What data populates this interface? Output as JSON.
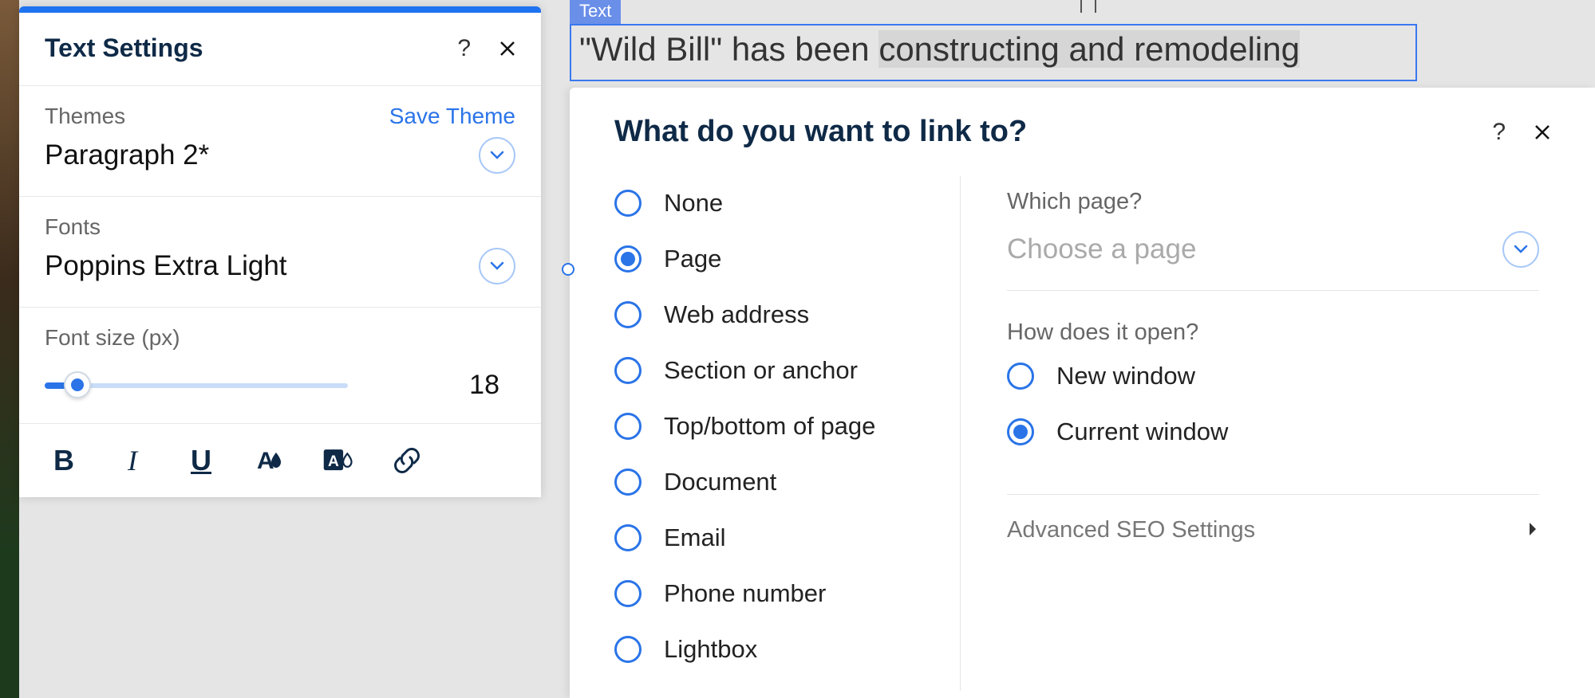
{
  "text_settings": {
    "title": "Text Settings",
    "themes_label": "Themes",
    "save_theme": "Save Theme",
    "theme_value": "Paragraph 2*",
    "fonts_label": "Fonts",
    "font_value": "Poppins Extra Light",
    "fontsize_label": "Font size (px)",
    "fontsize_value": "18",
    "toolbar": {
      "bold": "B",
      "italic": "I",
      "underline": "U"
    }
  },
  "canvas": {
    "badge": "Text",
    "line_prefix": "\"Wild Bill\" has been ",
    "line_highlight": "constructing and remodeling"
  },
  "link_panel": {
    "title": "What do you want to link to?",
    "options": [
      {
        "label": "None",
        "selected": false
      },
      {
        "label": "Page",
        "selected": true
      },
      {
        "label": "Web address",
        "selected": false
      },
      {
        "label": "Section or anchor",
        "selected": false
      },
      {
        "label": "Top/bottom of page",
        "selected": false
      },
      {
        "label": "Document",
        "selected": false
      },
      {
        "label": "Email",
        "selected": false
      },
      {
        "label": "Phone number",
        "selected": false
      },
      {
        "label": "Lightbox",
        "selected": false
      }
    ],
    "which_page_label": "Which page?",
    "which_page_placeholder": "Choose a page",
    "how_open_label": "How does it open?",
    "open_options": [
      {
        "label": "New window",
        "selected": false
      },
      {
        "label": "Current window",
        "selected": true
      }
    ],
    "advanced_label": "Advanced SEO Settings"
  }
}
